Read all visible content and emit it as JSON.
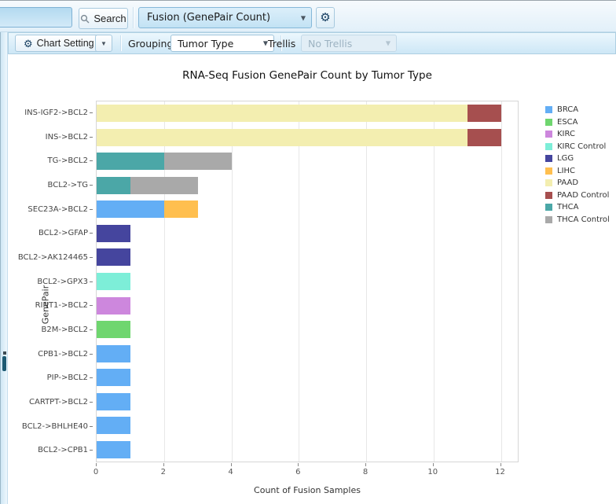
{
  "topbar": {
    "search_input_value": "",
    "search_button_label": "Search",
    "report_select_value": "Fusion (GenePair Count)"
  },
  "toolbar": {
    "chart_setting_label": "Chart Setting",
    "grouping_label": "Grouping",
    "grouping_value": "Tumor Type",
    "trellis_label": "Trellis",
    "trellis_value": "No Trellis"
  },
  "icons": {
    "gear_glyph": "⚙",
    "caret_glyph": "▼"
  },
  "chart_data": {
    "type": "bar",
    "orientation": "horizontal",
    "stacked": true,
    "title": "RNA-Seq Fusion GenePair Count by Tumor Type",
    "xlabel": "Count of Fusion Samples",
    "ylabel": "GenePair",
    "xlim": [
      0,
      12.5
    ],
    "xticks": [
      0,
      2,
      4,
      6,
      8,
      10,
      12
    ],
    "grid": true,
    "legend_position": "right",
    "legend": [
      "BRCA",
      "ESCA",
      "KIRC",
      "KIRC Control",
      "LGG",
      "LIHC",
      "PAAD",
      "PAAD Control",
      "THCA",
      "THCA Control"
    ],
    "colors": {
      "BRCA": "#63aef5",
      "ESCA": "#6fd66f",
      "KIRC": "#cd87dd",
      "KIRC Control": "#7deed8",
      "LGG": "#45459e",
      "LIHC": "#ffbf4f",
      "PAAD": "#f3eeb0",
      "PAAD Control": "#a64f4f",
      "THCA": "#4ba7a7",
      "THCA Control": "#a9a9a9"
    },
    "bars": [
      {
        "category": "INS-IGF2->BCL2",
        "segments": [
          {
            "series": "PAAD",
            "value": 11
          },
          {
            "series": "PAAD Control",
            "value": 1
          }
        ]
      },
      {
        "category": "INS->BCL2",
        "segments": [
          {
            "series": "PAAD",
            "value": 11
          },
          {
            "series": "PAAD Control",
            "value": 1
          }
        ]
      },
      {
        "category": "TG->BCL2",
        "segments": [
          {
            "series": "THCA",
            "value": 2
          },
          {
            "series": "THCA Control",
            "value": 2
          }
        ]
      },
      {
        "category": "BCL2->TG",
        "segments": [
          {
            "series": "THCA",
            "value": 1
          },
          {
            "series": "THCA Control",
            "value": 2
          }
        ]
      },
      {
        "category": "SEC23A->BCL2",
        "segments": [
          {
            "series": "BRCA",
            "value": 2
          },
          {
            "series": "LIHC",
            "value": 1
          }
        ]
      },
      {
        "category": "BCL2->GFAP",
        "segments": [
          {
            "series": "LGG",
            "value": 1
          }
        ]
      },
      {
        "category": "BCL2->AK124465",
        "segments": [
          {
            "series": "LGG",
            "value": 1
          }
        ]
      },
      {
        "category": "BCL2->GPX3",
        "segments": [
          {
            "series": "KIRC Control",
            "value": 1
          }
        ]
      },
      {
        "category": "RINT1->BCL2",
        "segments": [
          {
            "series": "KIRC",
            "value": 1
          }
        ]
      },
      {
        "category": "B2M->BCL2",
        "segments": [
          {
            "series": "ESCA",
            "value": 1
          }
        ]
      },
      {
        "category": "CPB1->BCL2",
        "segments": [
          {
            "series": "BRCA",
            "value": 1
          }
        ]
      },
      {
        "category": "PIP->BCL2",
        "segments": [
          {
            "series": "BRCA",
            "value": 1
          }
        ]
      },
      {
        "category": "CARTPT->BCL2",
        "segments": [
          {
            "series": "BRCA",
            "value": 1
          }
        ]
      },
      {
        "category": "BCL2->BHLHE40",
        "segments": [
          {
            "series": "BRCA",
            "value": 1
          }
        ]
      },
      {
        "category": "BCL2->CPB1",
        "segments": [
          {
            "series": "BRCA",
            "value": 1
          }
        ]
      }
    ]
  }
}
